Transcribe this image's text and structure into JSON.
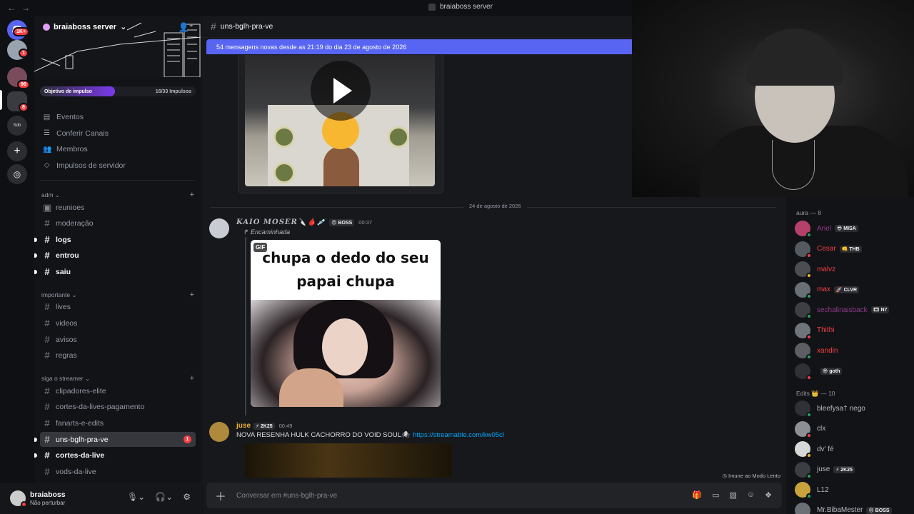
{
  "window": {
    "title": "braiaboss server"
  },
  "rail": {
    "badges": [
      "1K+",
      "1",
      "96",
      "8"
    ],
    "label_sdb": "Sdb"
  },
  "server": {
    "name": "braiaboss server",
    "boost_label": "Objetivo de impulso",
    "boost_count": "16/33 Impulsos",
    "boost_progress": 0.48
  },
  "menu": [
    "Eventos",
    "Conferir Canais",
    "Membros",
    "Impulsos de servidor"
  ],
  "categories": {
    "adm": "adm",
    "importante": "importante",
    "siga": "siga o streamer"
  },
  "channels": {
    "reunioes": "reunioes",
    "moderacao": "moderação",
    "logs": "logs",
    "entrou": "entrou",
    "saiu": "saiu",
    "lives": "lives",
    "videos": "videos",
    "avisos": "avisos",
    "regras": "regras",
    "clipadores": "clipadores-elite",
    "cortes_pag": "cortes-da-lives-pagamento",
    "fanarts": "fanarts-e-edits",
    "uns": "uns-bglh-pra-ve",
    "uns_mentions": "1",
    "cortes_live": "cortes-da-live",
    "vods": "vods-da-live"
  },
  "user": {
    "name": "braiaboss",
    "status": "Não perturbar"
  },
  "chat": {
    "channel": "uns-bglh-pra-ve",
    "new_messages": "54 mensagens novas desde as 21:19 do dia 23 de agosto de 2026",
    "date_separator": "24 de agosto de 2026",
    "msg1": {
      "author": "KAIO MOSER🔪🩸💉",
      "tag": "😠 BOSS",
      "time": "00:37",
      "forwarded": "↱ Encaminhada",
      "gif_badge": "GIF",
      "gif_caption": "chupa o dedo do seu papai chupa"
    },
    "msg2": {
      "author": "juse",
      "tag": "⚡ 2K25",
      "time": "00:49",
      "text": "NOVA RESENHA HULK CACHORRO DO VOID SOUL🕷",
      "link": "https://streamable.com/kw05cl"
    },
    "slowmode": "Imune ao Modo Lento",
    "composer_placeholder": "Conversar em #uns-bglh-pra-ve"
  },
  "members": {
    "group1": "aura — 8",
    "group2": "Edits 👑 — 10",
    "list1": [
      {
        "name": "Ariel",
        "tag": "😎 MISA",
        "color": "#8e3a8a"
      },
      {
        "name": "Cesar",
        "tag": "👊 THB",
        "color": "#f23f43"
      },
      {
        "name": "malvz",
        "tag": "",
        "color": "#f23f43"
      },
      {
        "name": "max",
        "tag": "🚀 CLVR",
        "color": "#f23f43"
      },
      {
        "name": "sechalinaisback",
        "tag": "🎞 N7",
        "color": "#8e3a8a"
      },
      {
        "name": "Thithi",
        "tag": "",
        "color": "#f23f43"
      },
      {
        "name": "xandin",
        "tag": "",
        "color": "#f23f43"
      },
      {
        "name": "",
        "tag": "😎 goth",
        "color": "#f23f43"
      }
    ],
    "list2": [
      {
        "name": "bleefysa† nego",
        "tag": "",
        "color": "#b5bac1"
      },
      {
        "name": "clx",
        "tag": "",
        "color": "#b5bac1"
      },
      {
        "name": "dv' fé",
        "tag": "",
        "color": "#b5bac1"
      },
      {
        "name": "juse",
        "tag": "⚡ 2K25",
        "color": "#b5bac1"
      },
      {
        "name": "L12",
        "tag": "",
        "color": "#b5bac1"
      },
      {
        "name": "Mr.BibaMester",
        "tag": "😠 BOSS",
        "color": "#b5bac1"
      }
    ]
  }
}
